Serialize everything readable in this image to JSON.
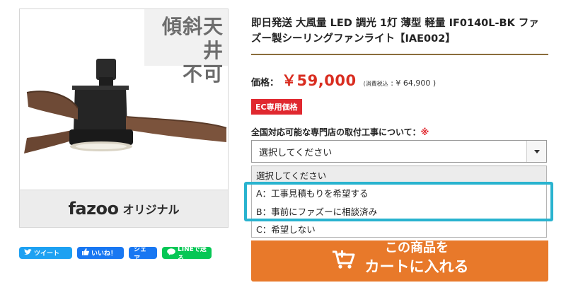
{
  "product_image": {
    "ceiling_notice_line1": "傾斜天井",
    "ceiling_notice_line2": "不可",
    "brand_logo": "fazoo",
    "brand_subtitle": "オリジナル"
  },
  "share": {
    "tweet": "ツイート",
    "like": "いいね！",
    "share": "シェア",
    "line": "LINEで送る"
  },
  "product": {
    "title": "即日発送 大風量 LED 調光 1灯 薄型 軽量 IF0140L-BK ファズー製シーリングファンライト【IAE002】",
    "price_label": "価格：",
    "price": "￥59,000",
    "tax_note_prefix": "(消費税込",
    "tax_note_value": ": ¥ 64,900 )",
    "ec_badge": "EC専用価格"
  },
  "install": {
    "label": "全国対応可能な専門店の取付工事について：",
    "required_mark": "※",
    "selected": "選択してください",
    "options": [
      "選択してください",
      "A：工事見積もりを希望する",
      "B：事前にファズーに相談済み",
      "C：希望しない"
    ]
  },
  "cart": {
    "line1": "この商品を",
    "line2": "カートに入れる"
  },
  "colors": {
    "price_red": "#d92d20",
    "badge_red": "#e0282f",
    "cart_orange": "#e8792a",
    "highlight_cyan": "#29b3cf"
  }
}
